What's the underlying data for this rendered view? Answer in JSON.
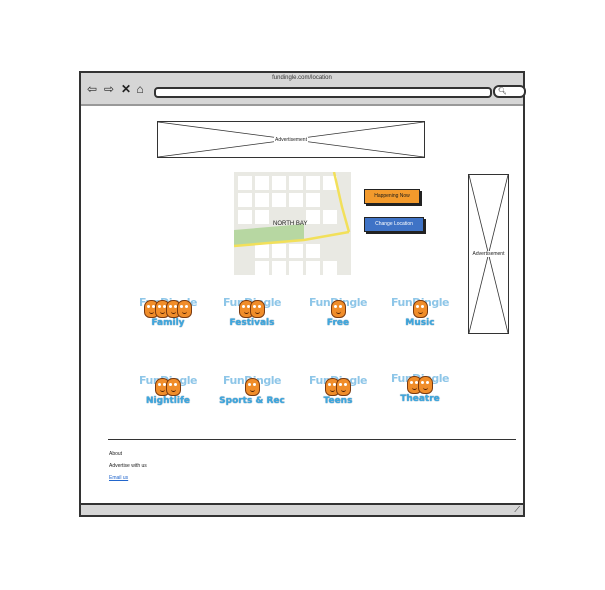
{
  "browser": {
    "url": "fundingle.com/location",
    "back_icon": "arrow-left-icon",
    "forward_icon": "arrow-right-icon",
    "close_icon": "close-icon",
    "home_icon": "home-icon",
    "search_icon": "search-icon"
  },
  "ads": {
    "top_label": "Advertisement",
    "side_label": "Advertisement"
  },
  "map": {
    "city_label": "NORTH BAY"
  },
  "buttons": {
    "happening_now": "Happening Now",
    "change_location": "Change Location",
    "happening_color": "#f39a2c",
    "change_color": "#3f73c6"
  },
  "categories": [
    {
      "brand": "FunDingle",
      "label": "Family",
      "mascots": 4
    },
    {
      "brand": "FunDingle",
      "label": "Festivals",
      "mascots": 2
    },
    {
      "brand": "FunDingle",
      "label": "Free",
      "mascots": 1
    },
    {
      "brand": "FunDingle",
      "label": "Music",
      "mascots": 1
    },
    {
      "brand": "FunDingle",
      "label": "Nightlife",
      "mascots": 2
    },
    {
      "brand": "FunDingle",
      "label": "Sports & Rec",
      "mascots": 1
    },
    {
      "brand": "FunDingle",
      "label": "Teens",
      "mascots": 2
    },
    {
      "brand": "FunDingle",
      "label": "Theatre",
      "mascots": 2
    }
  ],
  "footer": {
    "about": "About",
    "advertise": "Advertise with us",
    "email": "Email us"
  }
}
